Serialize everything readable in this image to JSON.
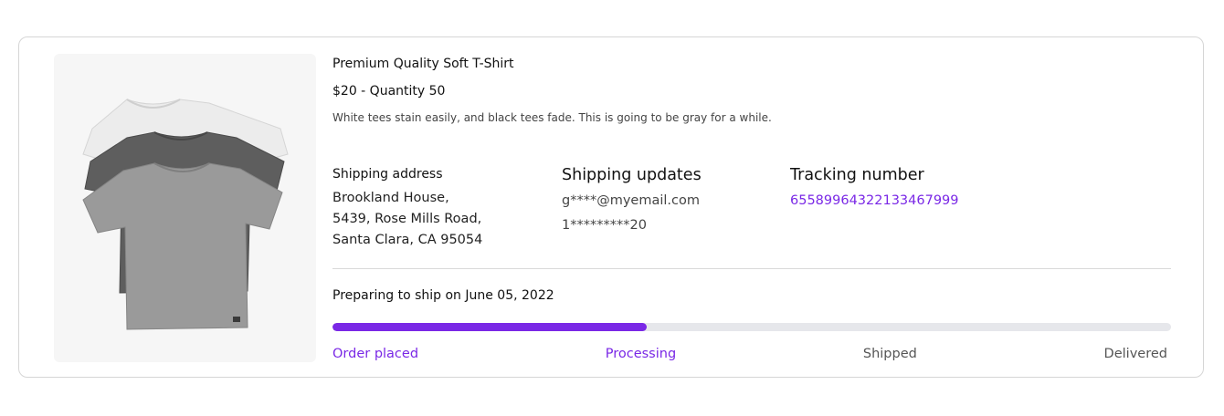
{
  "product": {
    "name": "Premium Quality Soft T-Shirt",
    "price_quantity": "$20 - Quantity 50",
    "description": "White tees stain easily, and black tees fade. This is going to be gray for a while.",
    "image_icon": "tshirt-stack-image"
  },
  "shipping_address": {
    "heading": "Shipping address",
    "lines": [
      "Brookland House,",
      "5439, Rose Mills Road,",
      "Santa Clara, CA 95054"
    ]
  },
  "shipping_updates": {
    "heading": "Shipping updates",
    "email": "g****@myemail.com",
    "phone": "1*********20"
  },
  "tracking": {
    "heading": "Tracking number",
    "number": "655899643221334679​99"
  },
  "status": {
    "text": "Preparing to ship on June 05, 2022",
    "progress_fraction": 0.375
  },
  "steps": [
    {
      "label": "Order placed",
      "state": "done"
    },
    {
      "label": "Processing",
      "state": "done"
    },
    {
      "label": "Shipped",
      "state": "todo"
    },
    {
      "label": "Delivered",
      "state": "todo"
    }
  ],
  "colors": {
    "accent": "#7a28e6",
    "track": "#e6e7eb"
  }
}
